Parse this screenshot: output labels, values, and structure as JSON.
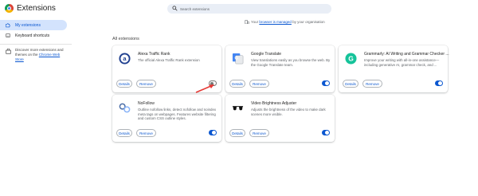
{
  "header": {
    "title": "Extensions",
    "search_placeholder": "Search extensions"
  },
  "managed_notice": {
    "prefix": "Your ",
    "link": "browser is managed",
    "suffix": " by your organisation"
  },
  "sidebar": {
    "items": [
      {
        "label": "My extensions",
        "icon": "puzzle-icon",
        "active": true
      },
      {
        "label": "Keyboard shortcuts",
        "icon": "keyboard-icon",
        "active": false
      }
    ],
    "promo_text": "Discover more extensions and themes on the ",
    "promo_link": "Chrome Web Store"
  },
  "main": {
    "section_title": "All extensions",
    "details_label": "Details",
    "remove_label": "Remove",
    "extensions": [
      {
        "name": "Alexa Traffic Rank",
        "description": "The official Alexa Traffic Rank extension",
        "icon": "alexa-icon",
        "enabled": false
      },
      {
        "name": "Google Translate",
        "description": "View translations easily as you browse the web. By the Google Translate team.",
        "icon": "translate-icon",
        "enabled": true
      },
      {
        "name": "Grammarly: AI Writing and Grammar Checker ...",
        "description": "Improve your writing with all-in-one assistance—including generative AI, grammar check, and ...",
        "icon": "grammarly-icon",
        "enabled": true
      },
      {
        "name": "NoFollow",
        "description": "Outline nofollow links, detect nofollow and noindex meta tags on webpages. Features website filtering and custom CSS outline styles.",
        "icon": "nofollow-icon",
        "enabled": true
      },
      {
        "name": "Video Brightness Adjuster",
        "description": "Adjusts the brightness of the video to make dark scenes more visible.",
        "icon": "sunglasses-icon",
        "enabled": true
      }
    ]
  },
  "colors": {
    "accent": "#0b57d0",
    "active_nav_bg": "#d3e3fd",
    "annotation_arrow": "#e53935"
  }
}
